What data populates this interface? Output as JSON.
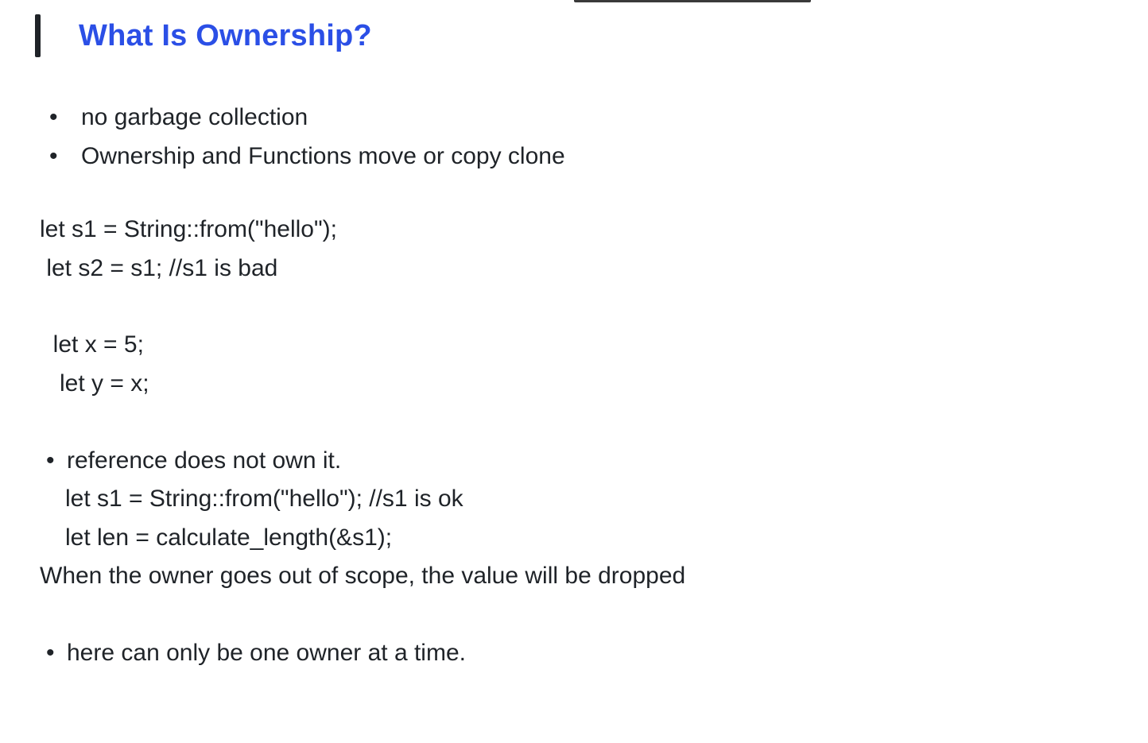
{
  "heading": "What Is Ownership?",
  "bullets_top": [
    "no  garbage collection",
    "Ownership and Functions     move or copy clone"
  ],
  "code_lines": [
    "let s1 = String::from(\"hello\");",
    " let s2 = s1; //s1 is bad",
    "",
    "  let x = 5;",
    "   let y = x;"
  ],
  "ref_bullet": "reference  does not own it.",
  "ref_sub_lines": [
    "let s1 = String::from(\"hello\");  //s1 is ok",
    "let len = calculate_length(&s1);"
  ],
  "scope_line": "When the owner goes out of scope, the value will be dropped",
  "last_bullet": "here can only be one owner at a time."
}
